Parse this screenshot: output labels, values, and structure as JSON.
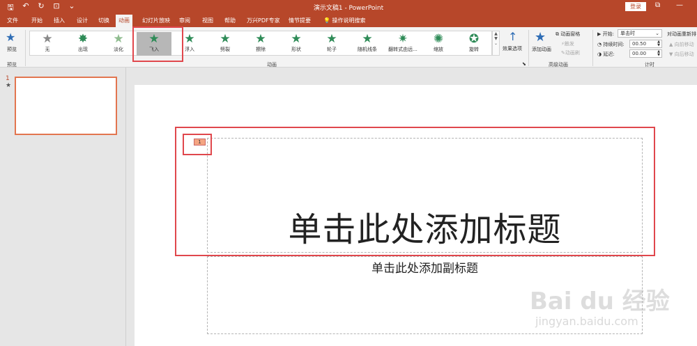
{
  "window": {
    "title": "演示文稿1  -  PowerPoint",
    "login_label": "登录",
    "restore_glyph": "⧉",
    "minimize_glyph": "—"
  },
  "qat": {
    "save": "🖫",
    "undo": "↶",
    "redo": "↻",
    "present": "⊡",
    "more": "⌄"
  },
  "tabs": [
    {
      "label": "文件"
    },
    {
      "label": "开始"
    },
    {
      "label": "插入"
    },
    {
      "label": "设计"
    },
    {
      "label": "切换"
    },
    {
      "label": "动画"
    },
    {
      "label": "幻灯片放映"
    },
    {
      "label": "审阅"
    },
    {
      "label": "视图"
    },
    {
      "label": "帮助"
    },
    {
      "label": "万兴PDF专家"
    },
    {
      "label": "情节提要"
    },
    {
      "label": "操作说明搜索"
    }
  ],
  "ribbon": {
    "preview": {
      "label": "预览",
      "group": "预览"
    },
    "animations": [
      {
        "label": "无"
      },
      {
        "label": "出现"
      },
      {
        "label": "淡化"
      },
      {
        "label": "飞入"
      },
      {
        "label": "浮入"
      },
      {
        "label": "劈裂"
      },
      {
        "label": "擦除"
      },
      {
        "label": "形状"
      },
      {
        "label": "轮子"
      },
      {
        "label": "随机线条"
      },
      {
        "label": "翻转式由远..."
      },
      {
        "label": "缩放"
      },
      {
        "label": "旋转"
      }
    ],
    "effect_options": "效果选项",
    "animation_group": "动画",
    "add_animation": "添加动画",
    "animation_pane": "动画窗格",
    "trigger": "触发",
    "animation_painter": "动画刷",
    "advanced_group": "高级动画",
    "start_label": "开始:",
    "start_value": "单击时",
    "duration_label": "持续时间:",
    "duration_value": "00.50",
    "delay_label": "延迟:",
    "delay_value": "00.00",
    "timing_group": "计时",
    "reorder_title": "对动画重新排",
    "move_earlier": "向前移动",
    "move_later": "向后移动"
  },
  "slides_pane": {
    "number": "1",
    "star": "★"
  },
  "slide": {
    "title_placeholder": "单击此处添加标题",
    "subtitle_placeholder": "单击此处添加副标题",
    "animation_tag": "1"
  },
  "watermark": {
    "brand": "Bai du 经验",
    "url": "jingyan.baidu.com"
  }
}
